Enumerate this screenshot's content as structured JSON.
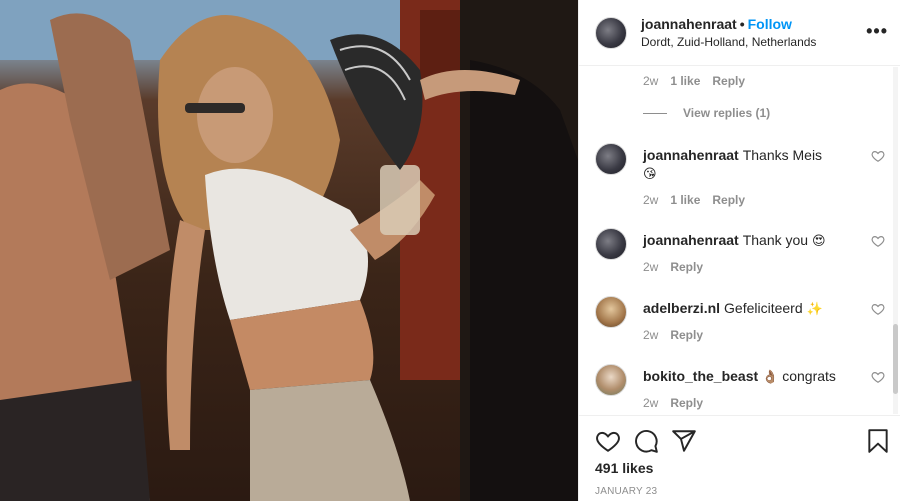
{
  "header": {
    "username": "joannahenraat",
    "separator": "•",
    "follow_label": "Follow",
    "location": "Dordt, Zuid-Holland, Netherlands",
    "more_label": "•••"
  },
  "first_meta": {
    "age": "2w",
    "likes": "1 like",
    "reply": "Reply"
  },
  "view_replies": "View replies (1)",
  "comments": [
    {
      "user": "joannahenraat",
      "text": "Thanks Meis",
      "emoji": "😘",
      "age": "2w",
      "likes": "1 like",
      "reply": "Reply"
    },
    {
      "user": "joannahenraat",
      "text": "Thank you",
      "emoji": "😍",
      "age": "2w",
      "likes": "",
      "reply": "Reply"
    },
    {
      "user": "adelberzi.nl",
      "text": "Gefeliciteerd",
      "emoji": "✨",
      "age": "2w",
      "likes": "",
      "reply": "Reply"
    },
    {
      "user": "bokito_the_beast",
      "text": "congrats",
      "emoji": "👌🏽",
      "age": "2w",
      "likes": "",
      "reply": "Reply"
    }
  ],
  "footer": {
    "likes": "491 likes",
    "date": "JANUARY 23"
  },
  "icons": {
    "like": "heart-icon",
    "comment": "comment-icon",
    "share": "share-icon",
    "save": "bookmark-icon"
  },
  "colors": {
    "accent": "#0095f6",
    "muted": "#8e8e8e",
    "text": "#262626",
    "border": "#efefef"
  }
}
